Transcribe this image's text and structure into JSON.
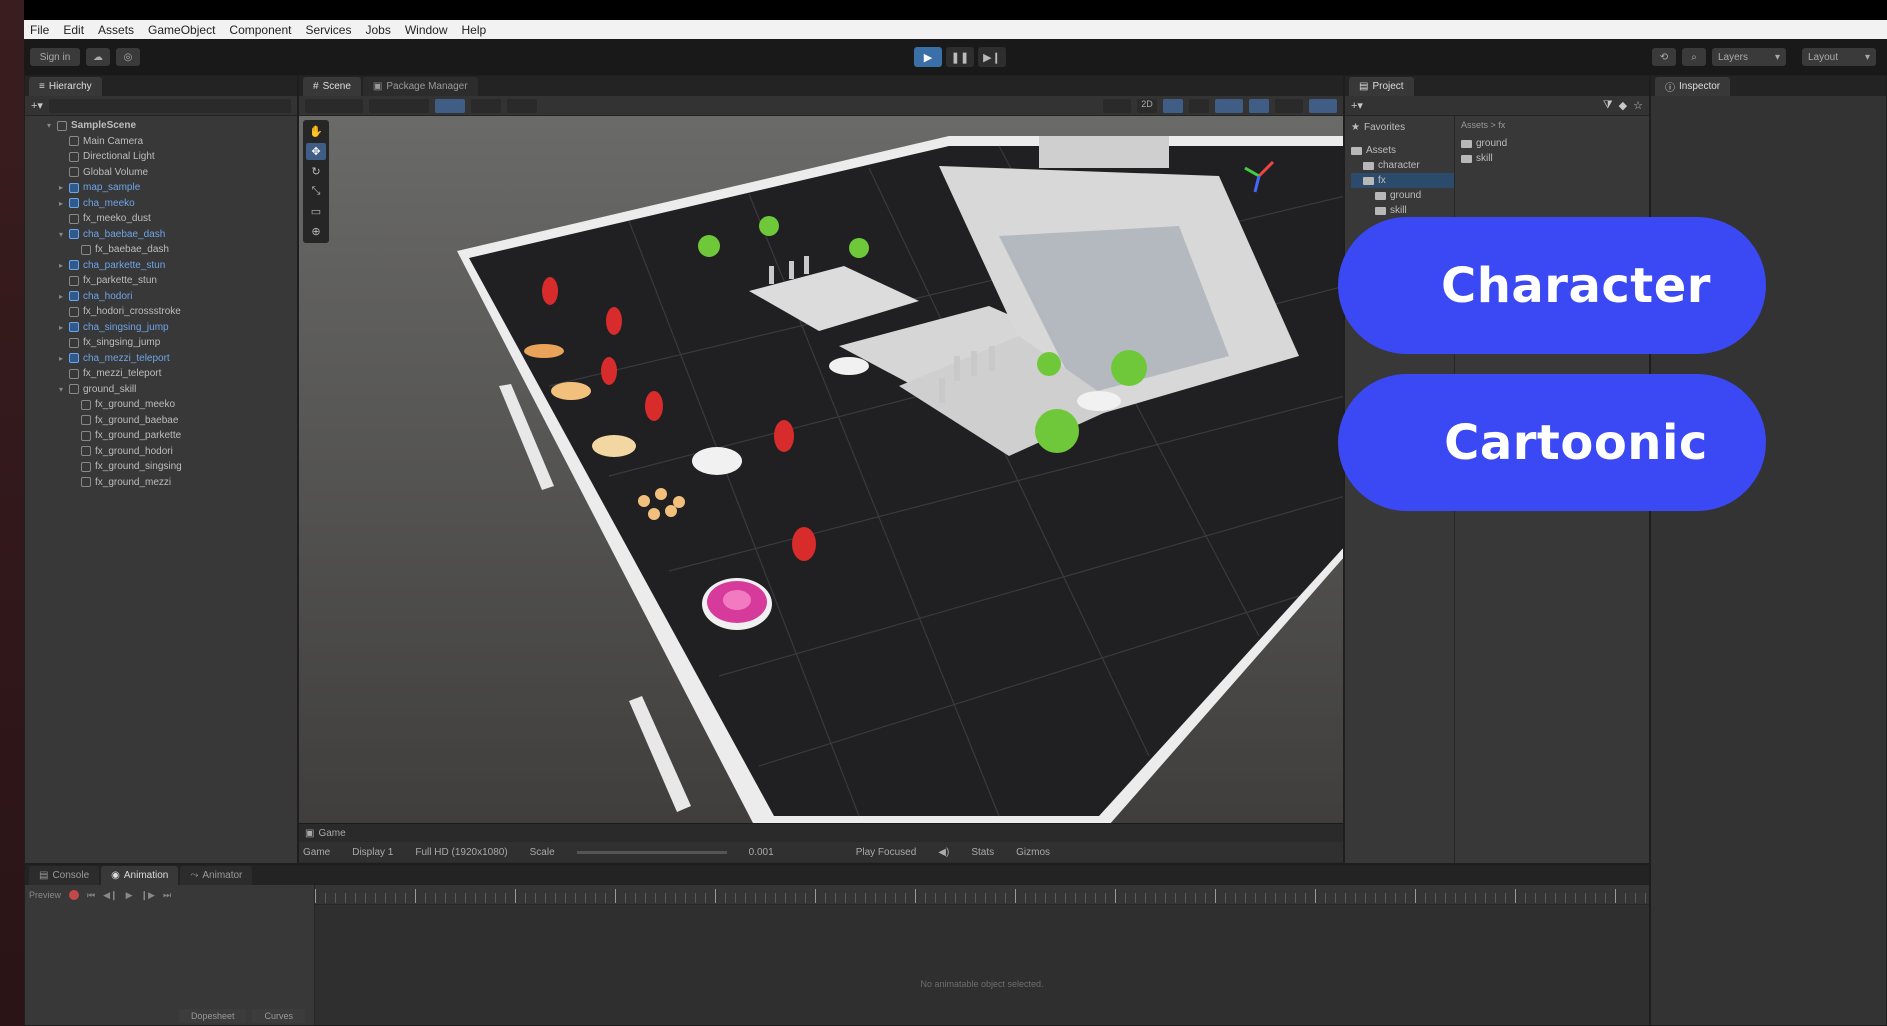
{
  "menu": [
    "File",
    "Edit",
    "Assets",
    "GameObject",
    "Component",
    "Services",
    "Jobs",
    "Window",
    "Help"
  ],
  "toolbar": {
    "sign_in": "Sign in",
    "layers": "Layers",
    "layout": "Layout"
  },
  "hierarchy": {
    "tab": "Hierarchy",
    "items": [
      {
        "label": "SampleScene",
        "indent": 1,
        "kind": "scene"
      },
      {
        "label": "Main Camera",
        "indent": 2,
        "kind": "obj"
      },
      {
        "label": "Directional Light",
        "indent": 2,
        "kind": "obj"
      },
      {
        "label": "Global Volume",
        "indent": 2,
        "kind": "obj"
      },
      {
        "label": "map_sample",
        "indent": 2,
        "kind": "prefab"
      },
      {
        "label": "cha_meeko",
        "indent": 2,
        "kind": "prefab"
      },
      {
        "label": "fx_meeko_dust",
        "indent": 2,
        "kind": "obj"
      },
      {
        "label": "cha_baebae_dash",
        "indent": 2,
        "kind": "prefab"
      },
      {
        "label": "fx_baebae_dash",
        "indent": 3,
        "kind": "obj"
      },
      {
        "label": "cha_parkette_stun",
        "indent": 2,
        "kind": "prefab"
      },
      {
        "label": "fx_parkette_stun",
        "indent": 2,
        "kind": "obj"
      },
      {
        "label": "cha_hodori",
        "indent": 2,
        "kind": "prefab"
      },
      {
        "label": "fx_hodori_crossstroke",
        "indent": 2,
        "kind": "obj"
      },
      {
        "label": "cha_singsing_jump",
        "indent": 2,
        "kind": "prefab"
      },
      {
        "label": "fx_singsing_jump",
        "indent": 2,
        "kind": "obj"
      },
      {
        "label": "cha_mezzi_teleport",
        "indent": 2,
        "kind": "prefab"
      },
      {
        "label": "fx_mezzi_teleport",
        "indent": 2,
        "kind": "obj"
      },
      {
        "label": "ground_skill",
        "indent": 2,
        "kind": "obj"
      },
      {
        "label": "fx_ground_meeko",
        "indent": 3,
        "kind": "obj"
      },
      {
        "label": "fx_ground_baebae",
        "indent": 3,
        "kind": "obj"
      },
      {
        "label": "fx_ground_parkette",
        "indent": 3,
        "kind": "obj"
      },
      {
        "label": "fx_ground_hodori",
        "indent": 3,
        "kind": "obj"
      },
      {
        "label": "fx_ground_singsing",
        "indent": 3,
        "kind": "obj"
      },
      {
        "label": "fx_ground_mezzi",
        "indent": 3,
        "kind": "obj"
      }
    ]
  },
  "scene": {
    "tab_scene": "Scene",
    "tab_package": "Package Manager",
    "shading": "Shaded",
    "mode": "2D"
  },
  "game": {
    "tab": "Game",
    "mode": "Game",
    "display": "Display 1",
    "resolution": "Full HD (1920x1080)",
    "scale_label": "Scale",
    "scale_value": "0.001",
    "play_mode": "Play Focused",
    "stats": "Stats",
    "gizmos": "Gizmos"
  },
  "project": {
    "tab": "Project",
    "favorites": "Favorites",
    "assets": "Assets",
    "tree": [
      "character",
      "fx",
      "ground",
      "skill"
    ],
    "breadcrumb": "Assets > fx",
    "contents": [
      "ground",
      "skill"
    ]
  },
  "inspector": {
    "tab": "Inspector"
  },
  "bottom": {
    "tab_console": "Console",
    "tab_animation": "Animation",
    "tab_animator": "Animator",
    "preview": "Preview",
    "message": "No animatable object selected.",
    "dopesheet": "Dopesheet",
    "curves": "Curves"
  },
  "overlay": {
    "pill1": "Character",
    "pill2": "Cartoonic"
  },
  "colors": {
    "pill_bg": "#3b49f5",
    "play_active": "#3b6fa8",
    "prefab_text": "#6fa4e8"
  }
}
